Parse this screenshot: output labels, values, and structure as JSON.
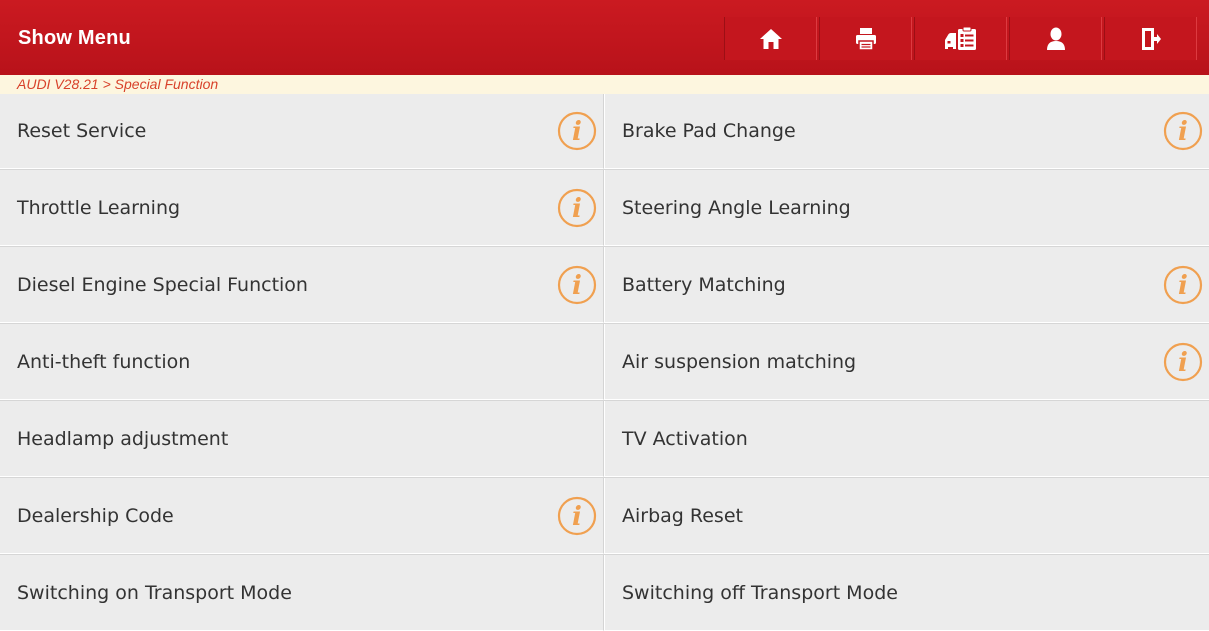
{
  "header": {
    "title": "Show Menu",
    "accent_color": "#c4161e"
  },
  "toolbar": {
    "buttons": [
      {
        "name": "home-icon"
      },
      {
        "name": "print-icon"
      },
      {
        "name": "vehicle-report-icon"
      },
      {
        "name": "user-icon"
      },
      {
        "name": "exit-icon"
      }
    ]
  },
  "breadcrumb": {
    "text": "AUDI V28.21 > Special Function"
  },
  "functions": {
    "rows": [
      {
        "left": {
          "label": "Reset Service",
          "info": true
        },
        "right": {
          "label": "Brake Pad Change",
          "info": true
        }
      },
      {
        "left": {
          "label": "Throttle Learning",
          "info": true
        },
        "right": {
          "label": "Steering Angle Learning",
          "info": false
        }
      },
      {
        "left": {
          "label": "Diesel Engine Special Function",
          "info": true
        },
        "right": {
          "label": "Battery Matching",
          "info": true
        }
      },
      {
        "left": {
          "label": "Anti-theft function",
          "info": false
        },
        "right": {
          "label": "Air suspension matching",
          "info": true
        }
      },
      {
        "left": {
          "label": "Headlamp adjustment",
          "info": false
        },
        "right": {
          "label": "TV Activation",
          "info": false
        }
      },
      {
        "left": {
          "label": "Dealership Code",
          "info": true
        },
        "right": {
          "label": "Airbag Reset",
          "info": false
        }
      },
      {
        "left": {
          "label": "Switching on Transport Mode",
          "info": false
        },
        "right": {
          "label": "Switching off Transport Mode",
          "info": false
        }
      }
    ],
    "info_icon_color": "#f0a050"
  }
}
